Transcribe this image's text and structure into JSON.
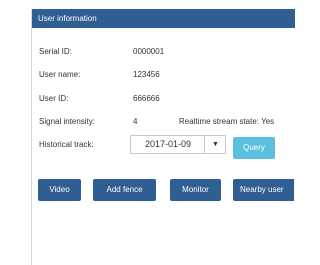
{
  "panel": {
    "title": "User information"
  },
  "info": {
    "serial_label": "Serial ID:",
    "serial_value": "0000001",
    "username_label": "User name:",
    "username_value": "123456",
    "userid_label": "User ID:",
    "userid_value": "666666",
    "signal_label": "Signal intensity:",
    "signal_value": "4",
    "stream_state": "Realtime stream state: Yes",
    "history_label": "Historical track:"
  },
  "history": {
    "date": "2017-01-09",
    "query_label": "Query"
  },
  "actions": {
    "video": "Video",
    "add_fence": "Add fence",
    "monitor": "Monitor",
    "nearby_user": "Nearby user"
  },
  "colors": {
    "header": "#2e5e92",
    "button": "#2e5e92",
    "query": "#5bc0de"
  },
  "icons": {
    "date_dropdown": "caret-down-icon"
  }
}
